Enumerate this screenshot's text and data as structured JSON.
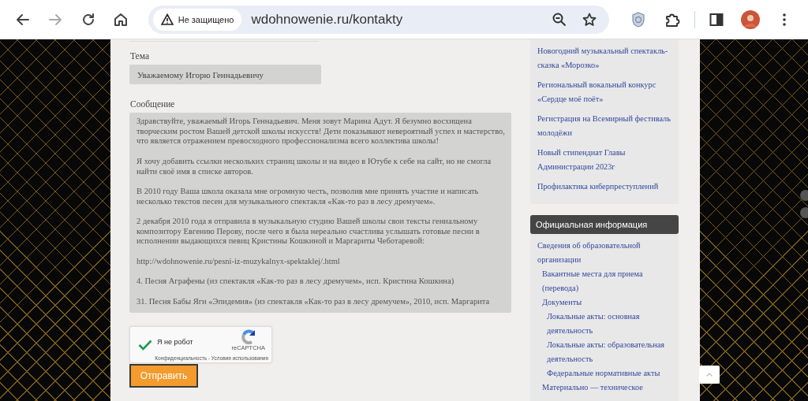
{
  "browser": {
    "forward_disabled": true,
    "security_label": "Не защищено",
    "url": "wdohnowenie.ru/kontakty"
  },
  "form": {
    "fields": [
      {
        "kind": "input",
        "label": "Тема",
        "value": "Уважаемому Игорю Геннадьевичу"
      },
      {
        "kind": "textarea",
        "label": "Сообщение",
        "paragraphs": [
          "Здравствуйте, уважаемый Игорь Геннадьевич. Меня зовут Марина Адут. Я безумно восхищена творческим ростом Вашей детской школы искусств! Дети показывают невероятный успех и мастерство, что является отражением превосходного профессионализма всего коллектива школы!",
          "Я хочу добавить ссылки нескольких страниц школы и на видео в Ютубе к себе на сайт, но не смогла найти своё имя в списке авторов.",
          "В 2010 году Ваша школа оказала мне огромную честь, позволив мне принять участие и написать несколько текстов песен для музыкального спектакля «Как-то раз в лесу дремучем».",
          "2 декабря 2010 года я отправила в музыкальную студию Вашей школы свои тексты гениальному композитору Евгению Перову, после чего я была нереально счастлива услышать готовые песни в исполнении выдающихся певиц Кристины Кошкиной и Маргариты Чеботаревой:",
          "http://wdohnowenie.ru/pesni-iz-muzykalnyx-spektaklej/.html",
          "4. Песня Аграфены (из спектакля «Как-то раз в лесу дремучем», исп. Кристина Кошкина)",
          "31. Песня Бабы Яги «Эпидемия» (из спектакля «Как-то раз в лесу дремучем», 2010, исп. Маргарита"
        ]
      }
    ],
    "captcha": {
      "label": "Я не робот",
      "checked": true,
      "brand": "reCAPTCHA",
      "links": "Конфиденциальность - Условия использования"
    },
    "submit": "Отправить"
  },
  "sidebar": {
    "news": [
      "Новогодний музыкальный спектакль-сказка «Морозко»",
      "Региональный вокальный конкурс «Сердце моё поёт»",
      "Регистрация на Всемирный фестиваль молодёжи",
      "Новый стипендиат Главы Администрации 2023г",
      "Профилактика киберпреступлений"
    ],
    "official": {
      "title": "Официальная информация",
      "items": [
        {
          "label": "Сведения об образовательной организации",
          "children": [
            {
              "label": "Вакантные места для приема (перевода)"
            },
            {
              "label": "Документы",
              "children": [
                {
                  "label": "Локальные акты: основная деятельность"
                },
                {
                  "label": "Локальные акты: образовательная деятельность"
                },
                {
                  "label": "Федеральные нормативные акты"
                }
              ]
            },
            {
              "label": "Материально — техническое"
            }
          ]
        }
      ]
    }
  }
}
